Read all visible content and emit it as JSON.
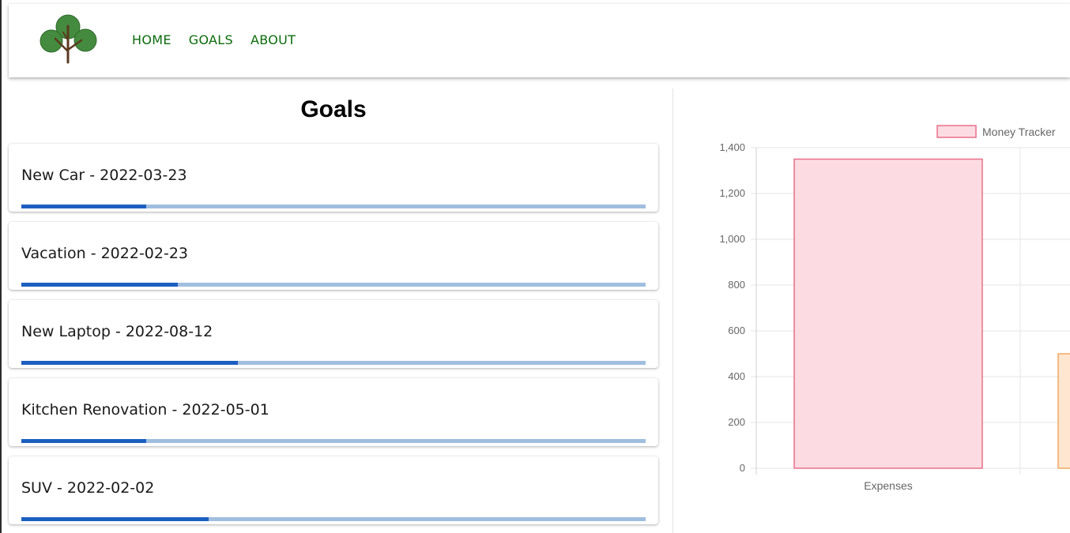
{
  "nav": {
    "logo_name": "tree-icon",
    "links": [
      "HOME",
      "GOALS",
      "ABOUT"
    ],
    "link_color": "#0b6b0b"
  },
  "goals": {
    "title": "Goals",
    "items": [
      {
        "label": "New Car - 2022-03-23",
        "progress": 0.2
      },
      {
        "label": "Vacation - 2022-02-23",
        "progress": 0.25
      },
      {
        "label": "New Laptop - 2022-08-12",
        "progress": 0.347
      },
      {
        "label": "Kitchen Renovation - 2022-05-01",
        "progress": 0.2
      },
      {
        "label": "SUV - 2022-02-02",
        "progress": 0.3
      }
    ],
    "progress_fill_color": "#1d5fc0",
    "progress_track_color": "#a0bedf"
  },
  "chart_data": {
    "type": "bar",
    "categories": [
      "Expenses",
      ""
    ],
    "series": [
      {
        "name": "Money Tracker",
        "values": [
          1350,
          500
        ]
      }
    ],
    "bar_fill_colors": [
      "#fddbe2",
      "#ffe6d1"
    ],
    "bar_border_colors": [
      "#e8708a",
      "#f0a865"
    ],
    "ylim": [
      0,
      1400
    ],
    "yticks": [
      "0",
      "200",
      "400",
      "600",
      "800",
      "1,000",
      "1,200",
      "1,400"
    ],
    "legend": "top-right",
    "grid": true
  }
}
